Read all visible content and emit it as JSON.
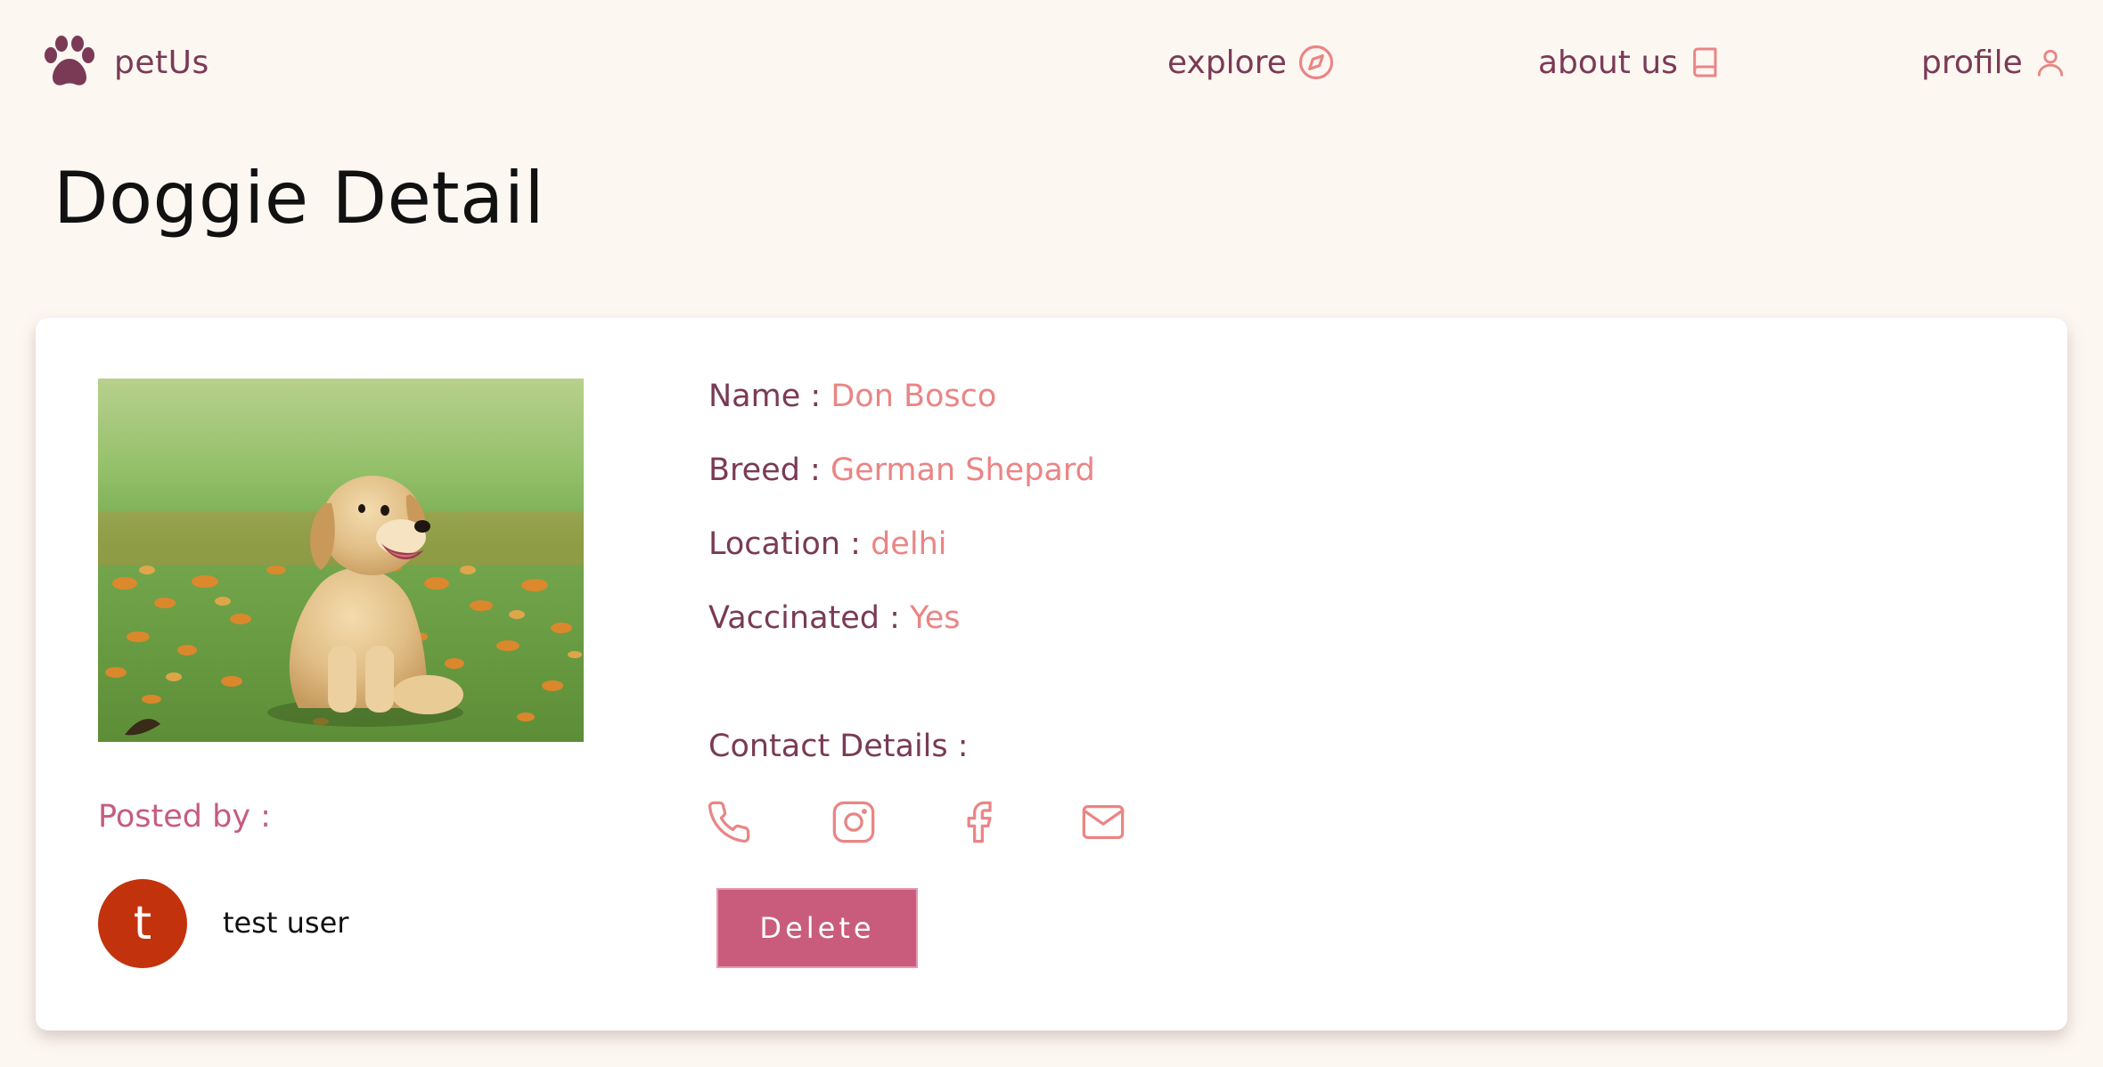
{
  "nav": {
    "brand": "petUs",
    "brand_icon": "paw-icon",
    "items": [
      {
        "label": "explore",
        "icon": "compass-icon"
      },
      {
        "label": "about us",
        "icon": "book-icon"
      },
      {
        "label": "profile",
        "icon": "user-icon"
      }
    ]
  },
  "page": {
    "title": "Doggie Detail"
  },
  "dog": {
    "fields": [
      {
        "label": "Name :",
        "value": "Don Bosco"
      },
      {
        "label": "Breed :",
        "value": "German Shepard"
      },
      {
        "label": "Location :",
        "value": "delhi"
      },
      {
        "label": "Vaccinated :",
        "value": "Yes"
      }
    ]
  },
  "contact": {
    "label": "Contact Details :",
    "icons": [
      "phone-icon",
      "instagram-icon",
      "facebook-icon",
      "mail-icon"
    ]
  },
  "poster": {
    "label": "Posted by :",
    "avatar_letter": "t",
    "name": "test user"
  },
  "actions": {
    "delete_label": "Delete"
  },
  "colors": {
    "background": "#fdf7f2",
    "brand_dark": "#7a3a55",
    "accent_pink": "#ea8585",
    "button": "#c95c7c",
    "avatar": "#c2330d"
  }
}
